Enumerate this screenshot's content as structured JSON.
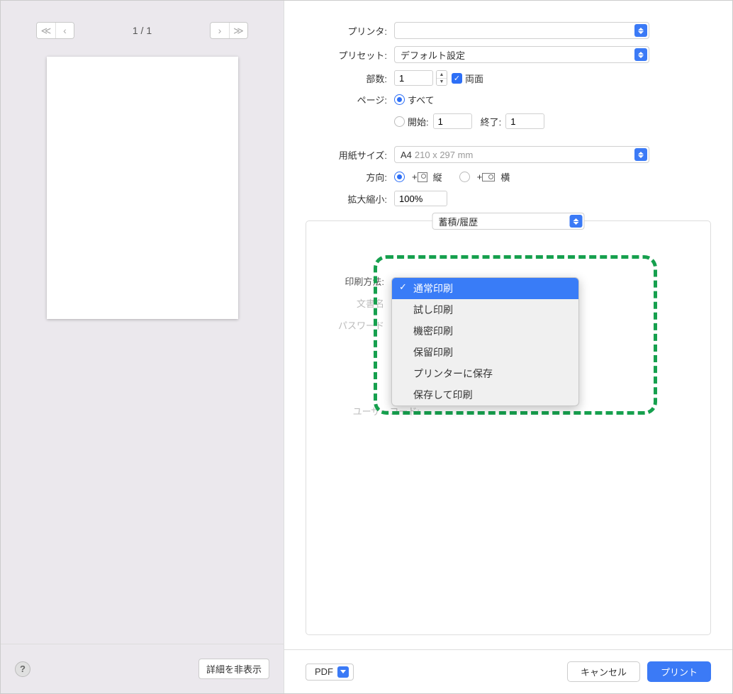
{
  "pager": {
    "counter": "1 / 1"
  },
  "form": {
    "printer_label": "プリンタ:",
    "printer_value": "　　　　　　",
    "preset_label": "プリセット:",
    "preset_value": "デフォルト設定",
    "copies_label": "部数:",
    "copies_value": "1",
    "duplex_label": "両面",
    "pages_label": "ページ:",
    "all_label": "すべて",
    "from_label": "開始:",
    "from_value": "1",
    "to_label": "終了:",
    "to_value": "1",
    "paper_label": "用紙サイズ:",
    "paper_value": "A4",
    "paper_dims": "210 x 297 mm",
    "orient_label": "方向:",
    "orient_v": "縦",
    "orient_h": "横",
    "scale_label": "拡大縮小:",
    "scale_value": "100%"
  },
  "panel": {
    "category_value": "蓄積/履歴",
    "print_method_label": "印刷方法:",
    "doc_label": "文書名",
    "pw_label": "パスワード",
    "user_label": "ユーザーコード:"
  },
  "dropdown": {
    "items": [
      "通常印刷",
      "試し印刷",
      "機密印刷",
      "保留印刷",
      "プリンターに保存",
      "保存して印刷"
    ]
  },
  "footer": {
    "help": "?",
    "hide_details": "詳細を非表示",
    "pdf": "PDF",
    "cancel": "キャンセル",
    "print": "プリント"
  }
}
